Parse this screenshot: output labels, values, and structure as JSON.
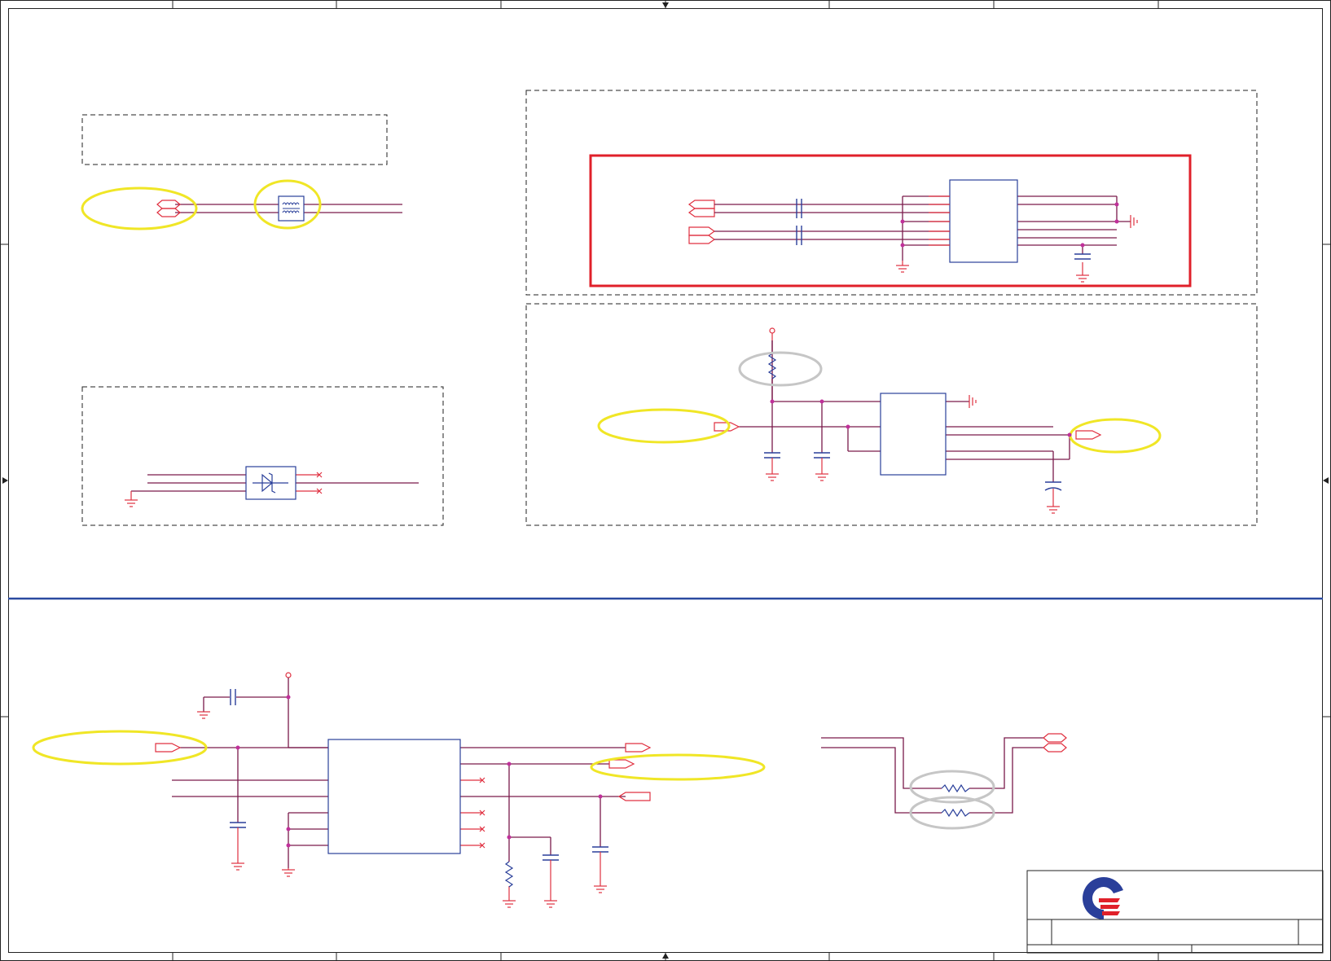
{
  "title": "",
  "colors": {
    "wire": "#e03040",
    "part": "#2a3f9a",
    "net": "#7a1a4a",
    "junction": "#c0309a",
    "highlight_yellow": "#f0e626",
    "highlight_gray": "#c6c6c6",
    "selection_red": "#e0202a",
    "divider": "#2a4aa0",
    "frame": "#222222"
  },
  "title_block": {
    "logo": "company-logo"
  }
}
